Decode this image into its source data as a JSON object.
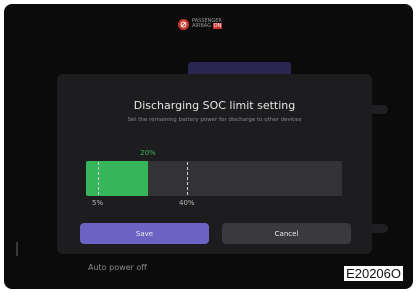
{
  "airbag": {
    "line1": "PASSENGER",
    "line2": "AIRBAG",
    "state": "ON"
  },
  "dialog": {
    "title": "Discharging SOC limit setting",
    "subtitle": "Set the remaining battery power for discharge to other devices",
    "slider": {
      "value_percent": 20,
      "value_label": "20%",
      "min_marker_label": "5%",
      "max_marker_label": "40%",
      "min_marker_percent": 5,
      "max_marker_percent": 40
    },
    "save_label": "Save",
    "cancel_label": "Cancel"
  },
  "background": {
    "bottom_item": "Auto power off"
  },
  "figure_code": "E20206O",
  "colors": {
    "accent_green": "#36b55a",
    "save_button": "#6a63c4",
    "cancel_button": "#3a3a3e",
    "airbag_red": "#c8372d"
  }
}
